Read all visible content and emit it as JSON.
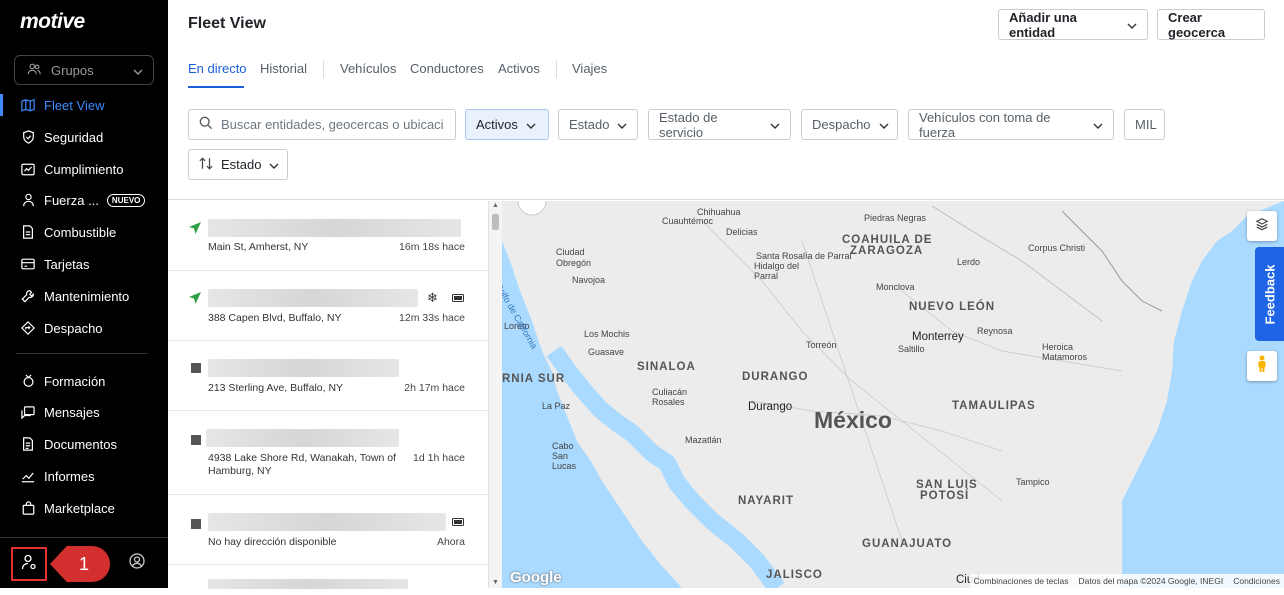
{
  "brand": "motive",
  "sidebar": {
    "groups_label": "Grupos",
    "items": [
      {
        "label": "Fleet View"
      },
      {
        "label": "Seguridad"
      },
      {
        "label": "Cumplimiento"
      },
      {
        "label": "Fuerza ...",
        "badge": "NUEVO"
      },
      {
        "label": "Combustible"
      },
      {
        "label": "Tarjetas"
      },
      {
        "label": "Mantenimiento"
      },
      {
        "label": "Despacho"
      },
      {
        "label": "Formación"
      },
      {
        "label": "Mensajes"
      },
      {
        "label": "Documentos"
      },
      {
        "label": "Informes"
      },
      {
        "label": "Marketplace"
      }
    ],
    "callout_number": "1"
  },
  "header": {
    "title": "Fleet View",
    "add_entity": "Añadir una entidad",
    "create_geofence": "Crear geocerca",
    "tabs": [
      "En directo",
      "Historial",
      "Vehículos",
      "Conductores",
      "Activos",
      "Viajes"
    ]
  },
  "filters": {
    "search_placeholder": "Buscar entidades, geocercas o ubicaci...",
    "activos": "Activos",
    "estado": "Estado",
    "estado_servicio": "Estado de servicio",
    "despacho": "Despacho",
    "toma_fuerza": "Vehículos con toma de fuerza",
    "mil": "MIL",
    "sort_estado": "Estado"
  },
  "list": [
    {
      "address": "Main St, Amherst, NY",
      "time": "16m 18s hace"
    },
    {
      "address": "388 Capen Blvd, Buffalo, NY",
      "time": "12m 33s hace"
    },
    {
      "address": "213 Sterling Ave, Buffalo, NY",
      "time": "2h 17m hace"
    },
    {
      "address": "4938 Lake Shore Rd, Wanakah, Town of Hamburg, NY",
      "time": "1d 1h hace"
    },
    {
      "address": "No hay dirección disponible",
      "time": "Ahora"
    }
  ],
  "map": {
    "country": "México",
    "states": [
      "COAHUILA DE",
      "ZARAGOZA",
      "NUEVO LEÓN",
      "SINALOA",
      "DURANGO",
      "TAMAULIPAS",
      "NAYARIT",
      "SAN LUIS",
      "POTOSÍ",
      "GUANAJUATO",
      "JALISCO",
      "RNIA SUR"
    ],
    "cities": [
      "Chihuahua",
      "Cuauhtémoc",
      "Delicias",
      "Piedras Negras",
      "Ciudad Obregón",
      "Navojoa",
      "Santa Rosalía de Parral",
      "Hidalgo del Parral",
      "Lerdo",
      "Corpus Christi",
      "Monclova",
      "Loreto",
      "Los Mochis",
      "Guasave",
      "Torreón",
      "Saltillo",
      "Monterrey",
      "Reynosa",
      "Heroica Matamoros",
      "Culiacán Rosales",
      "Durango",
      "La Paz",
      "Cabo San Lucas",
      "Mazatlán",
      "Tampico",
      "Ciud",
      "Golfo de California"
    ],
    "feedback": "Feedback",
    "google": "Google",
    "attribution": [
      "Combinaciones de teclas",
      "Datos del mapa ©2024 Google, INEGI",
      "Condiciones"
    ],
    "water_color": "#aadaff",
    "land_color": "#ececec"
  }
}
